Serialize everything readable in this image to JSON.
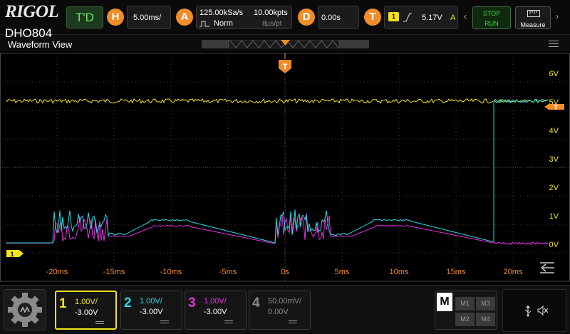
{
  "brand": {
    "logo": "RIGOL",
    "model": "DHO804"
  },
  "top": {
    "mode": "T'D",
    "horizontal": {
      "badge": "H",
      "scale": "5.00ms/"
    },
    "acquire": {
      "badge": "A",
      "sample_rate": "125.00kSa/s",
      "points": "10.00kpts",
      "mode": "Norm",
      "time_per_pt": "8µs/pt"
    },
    "delay": {
      "badge": "D",
      "value": "0.00s"
    },
    "trigger": {
      "badge": "T",
      "source": "1",
      "level": "5.17V",
      "mode_letter": "A"
    },
    "stop_label": "STOP",
    "run_label": "RUN",
    "measure_label": "Measure"
  },
  "waveform_view": {
    "title": "Waveform View",
    "trigger_marker": "T",
    "right_marker": "T",
    "ch1_marker": "1",
    "y_labels": [
      "6V",
      "5V",
      "4V",
      "3V",
      "2V",
      "1V",
      "0V"
    ],
    "x_labels": [
      "-20ms",
      "-15ms",
      "-10ms",
      "-5ms",
      "0s",
      "5ms",
      "10ms",
      "15ms",
      "20ms"
    ],
    "colors": {
      "ch1": "#f5e21c",
      "ch2": "#2ad8e0",
      "ch3": "#e030e0",
      "trigger": "#f08c2a",
      "grid": "#3a3a3a"
    }
  },
  "channels": [
    {
      "num": "1",
      "scale": "1.00V/",
      "offset": "-3.00V",
      "color": "#f5e21c",
      "active": true
    },
    {
      "num": "2",
      "scale": "1.00V/",
      "offset": "-3.00V",
      "color": "#2ad8e0",
      "active": false
    },
    {
      "num": "3",
      "scale": "1.00V/",
      "offset": "-3.00V",
      "color": "#e030e0",
      "active": false
    },
    {
      "num": "4",
      "scale": "50.00mV/",
      "offset": "0.00V",
      "color": "#8a8a8a",
      "active": false
    }
  ],
  "math": {
    "label": "M",
    "cells": [
      "M1",
      "M3",
      "M2",
      "M4"
    ]
  },
  "icons": {
    "home": "gear-home-icon",
    "usb": "usb-icon",
    "mute": "speaker-mute-icon",
    "trigger_edge": "rising-edge-icon"
  }
}
